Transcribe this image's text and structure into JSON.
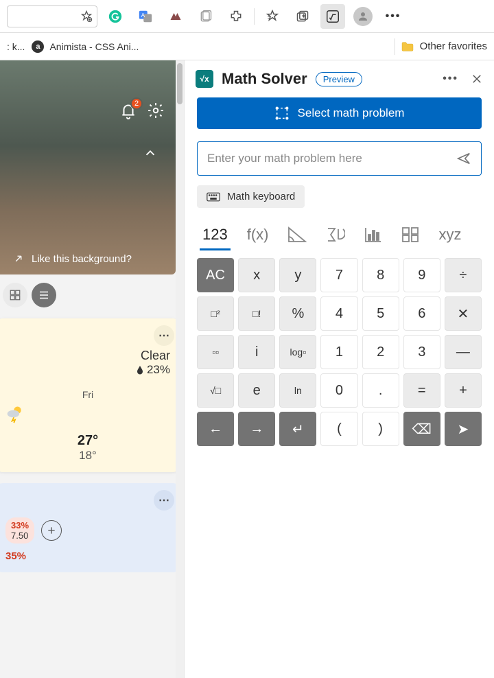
{
  "toolbar": {
    "notification_count": "2"
  },
  "favorites": {
    "item1_truncated": ": k...",
    "item2_label": "Animista - CSS Ani...",
    "other_label": "Other favorites"
  },
  "ntp": {
    "like_bg": "Like this background?",
    "weather": {
      "condition": "Clear",
      "humidity": "23%",
      "forecast_day": "Fri",
      "forecast_hi": "27°",
      "forecast_lo": "18°"
    },
    "stock": {
      "pct": "33%",
      "val": "7.50",
      "pct2": "35%"
    }
  },
  "solver": {
    "title": "Math Solver",
    "badge": "Preview",
    "select_btn": "Select math problem",
    "placeholder": "Enter your math problem here",
    "keyboard_btn": "Math keyboard",
    "tabs": {
      "t1": "123",
      "t2": "f(x)",
      "t6": "xyz"
    },
    "keys": {
      "r0": [
        "AC",
        "x",
        "y",
        "7",
        "8",
        "9",
        "÷"
      ],
      "r1": [
        "□²",
        "□!",
        "%",
        "4",
        "5",
        "6",
        "✕"
      ],
      "r2": [
        "▫▫",
        "i",
        "log▫",
        "1",
        "2",
        "3",
        "—"
      ],
      "r3": [
        "√□",
        "e",
        "ln",
        "0",
        ".",
        "=",
        "+"
      ],
      "r4": [
        "←",
        "→",
        "↵",
        "(",
        ")",
        "⌫",
        "➤"
      ]
    }
  }
}
